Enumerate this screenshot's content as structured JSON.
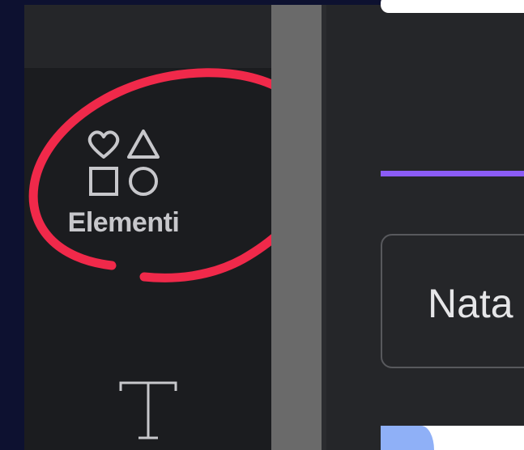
{
  "sidebar": {
    "items": [
      {
        "label": "Elementi",
        "icon": "shapes-icon"
      },
      {
        "label": "",
        "icon": "text-icon"
      }
    ]
  },
  "main": {
    "name_field_value": "Nata"
  },
  "colors": {
    "sidebar_bg": "#1b1c1f",
    "panel_bg": "#252629",
    "accent_purple": "#8b5cf6",
    "annotation_red": "#f0294a",
    "scrollbar": "#6a6a6a"
  }
}
